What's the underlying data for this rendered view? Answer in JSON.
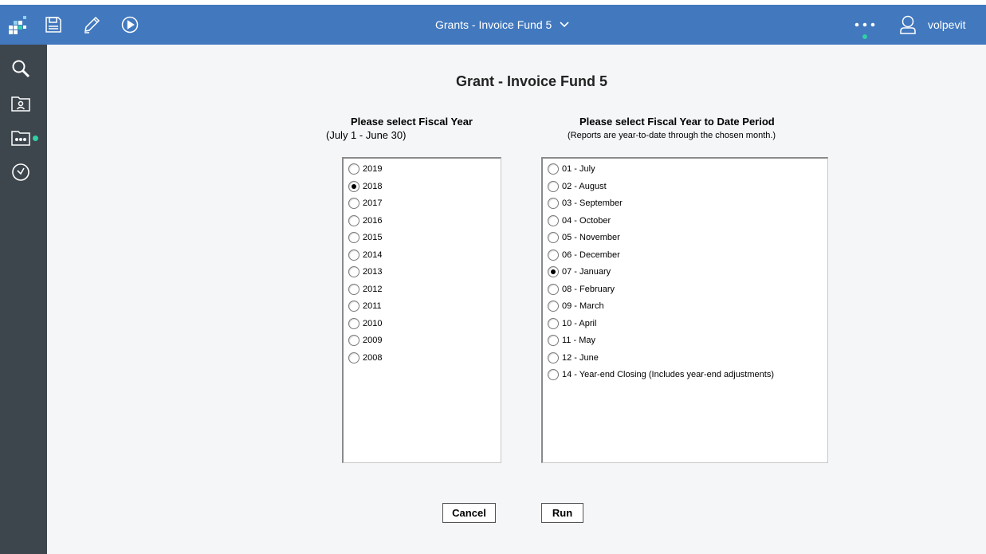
{
  "header": {
    "title": "Grants - Invoice Fund 5",
    "user": "volpevit",
    "icons": [
      "home-grid-icon",
      "save-icon",
      "edit-pencil-icon",
      "run-play-icon",
      "chevron-down-icon",
      "more-dots-icon",
      "user-icon"
    ],
    "accent": "#4178be",
    "notification_color": "#2fd0a4"
  },
  "sidebar": {
    "icons": [
      "search-icon",
      "team-folder-icon",
      "my-content-icon",
      "recent-clock-icon"
    ],
    "background": "#3d464d"
  },
  "main": {
    "title": "Grant - Invoice Fund 5",
    "fiscal_year": {
      "label": "Please select Fiscal Year",
      "sublabel": "(July 1 - June 30)",
      "options": [
        "2019",
        "2018",
        "2017",
        "2016",
        "2015",
        "2014",
        "2013",
        "2012",
        "2011",
        "2010",
        "2009",
        "2008"
      ],
      "selected": "2018"
    },
    "period": {
      "label": "Please select Fiscal Year to Date Period",
      "sublabel": "(Reports are year-to-date through the chosen month.)",
      "options": [
        "01 - July",
        "02 - August",
        "03 - September",
        "04 - October",
        "05 - November",
        "06 - December",
        "07 - January",
        "08 - February",
        "09 - March",
        "10 - April",
        "11 - May",
        "12 - June",
        "14 - Year-end Closing (Includes year-end adjustments)"
      ],
      "selected": "07 - January"
    },
    "buttons": {
      "cancel": "Cancel",
      "run": "Run"
    }
  }
}
